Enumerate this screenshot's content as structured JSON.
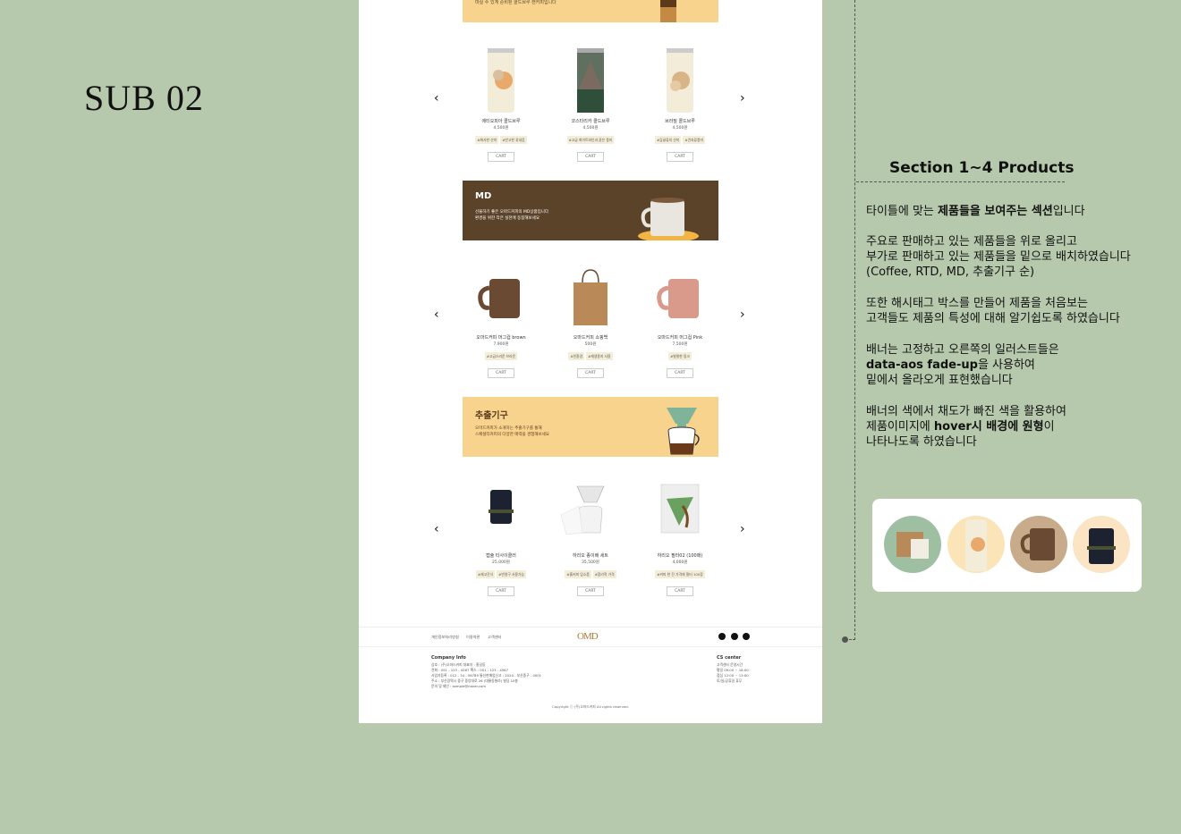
{
  "sub_title": "SUB 02",
  "top_banner_text": "마실 수 있게 준비된 콜드브루 캔커피입니다",
  "carousel_prev": "‹",
  "carousel_next": "›",
  "section_coffee": {
    "products": [
      {
        "name": "에티오피아 콜드브루",
        "price": "4,500원",
        "tags": [
          "#화사한 산미",
          "#반고한 꽃내음"
        ],
        "cart": "CART"
      },
      {
        "name": "코스타리카 콜드브루",
        "price": "4,500원",
        "tags": [
          "#고급 화이트와인과 같은 풍미"
        ],
        "cart": "CART"
      },
      {
        "name": "브라질 콜드브루",
        "price": "4,500원",
        "tags": [
          "#감귤류의 산미",
          "#견과류풍미"
        ],
        "cart": "CART"
      }
    ]
  },
  "banner_md": {
    "title": "MD",
    "sub": "선물하기 좋은 오마드커피의 MD상품입니다\n환경을 위한 작은 실천에 동참해보세요"
  },
  "section_md": {
    "products": [
      {
        "name": "오마드커피 머그컵 brown",
        "price": "7,900원",
        "tags": [
          "#고급스러운 브라운"
        ],
        "cart": "CART"
      },
      {
        "name": "오마드커피 쇼핑백",
        "price": "500원",
        "tags": [
          "#친환경",
          "#재생용지 사용"
        ],
        "cart": "CART"
      },
      {
        "name": "오마드커피 머그컵 Pink",
        "price": "7,500원",
        "tags": [
          "#발랄한 핑크"
        ],
        "cart": "CART"
      }
    ]
  },
  "banner_tools": {
    "title": "추출기구",
    "sub": "오마드커피가 소개하는 추출기구를 통해\n스페셜티커피의 다양한 매력을 경험해보세요"
  },
  "section_tools": {
    "products": [
      {
        "name": "캡슐 티사이클러",
        "price": "25,000원",
        "tags": [
          "#재고간식",
          "#반영구 사용가능"
        ],
        "cart": "CART"
      },
      {
        "name": "하리오 종이배 세트",
        "price": "35,500원",
        "tags": [
          "#흙커피 입소품",
          "#합리적 가격"
        ],
        "cart": "CART"
      },
      {
        "name": "하리오 필터02 (100매)",
        "price": "4,000원",
        "tags": [
          "#커피 한 잔 가격에 필터 100장"
        ],
        "cart": "CART"
      }
    ]
  },
  "footer": {
    "links": [
      "개인정보처리방침",
      "이용약관",
      "고객센터"
    ],
    "logo": "OMD",
    "company_title": "Company Info",
    "company_lines": "상호 : (주)오마드커피          대표자 : 홍길동\n전화 : 051 - 123 - 4567        팩스 : 051 - 123 - 4567\n사업자등록 : 012 - 34 - 56789        통신판매업신고 : 2024 - 부산중구 - 0001\n주소 : 부산광역시 중구 중앙대로 26 (대룡동빌라) 빌딩 10층\n문의 및 제안 : sample@naver.com",
    "cs_title": "CS center",
    "cs_lines": "고객센터 운영시간\n평일 09:00 ~ 18:00\n점심 12:00 ~ 13:00\n토/일/공휴일 휴무",
    "copyright": "Copyright ⓒ (주)오마드커피 All rights reserved."
  },
  "annotation": {
    "title": "Section 1~4   Products",
    "p1_pre": "타이틀에 맞는 ",
    "p1_bold": "제품들을 보여주는 섹션",
    "p1_post": "입니다",
    "p2": "주요로 판매하고 있는 제품들을 위로 올리고\n부가로 판매하고 있는 제품들을 밑으로 배치하였습니다\n(Coffee, RTD, MD, 추출기구 순)",
    "p3": "또한 해시태그 박스를 만들어 제품을 처음보는\n고객들도 제품의 특성에 대해 알기쉽도록 하였습니다",
    "p4_a": "배너는 고정하고 오른쪽의 일러스트들은",
    "p4_bold": "data-aos fade-up",
    "p4_b": "을 사용하여",
    "p4_c": "밑에서 올라오게 표현했습니다",
    "p5_a": "배너의 색에서 채도가 빠진 색을 활용하여",
    "p5_b": "제품이미지에 ",
    "p5_bold": "hover시 배경에 원형",
    "p5_c": "이",
    "p5_d": "나타나도록 하였습니다"
  },
  "colors": {
    "bg": "#b7c9ad",
    "banner_yellow": "#f8d38e",
    "banner_brown": "#5b432a",
    "tag_bg": "#f4edd7"
  }
}
